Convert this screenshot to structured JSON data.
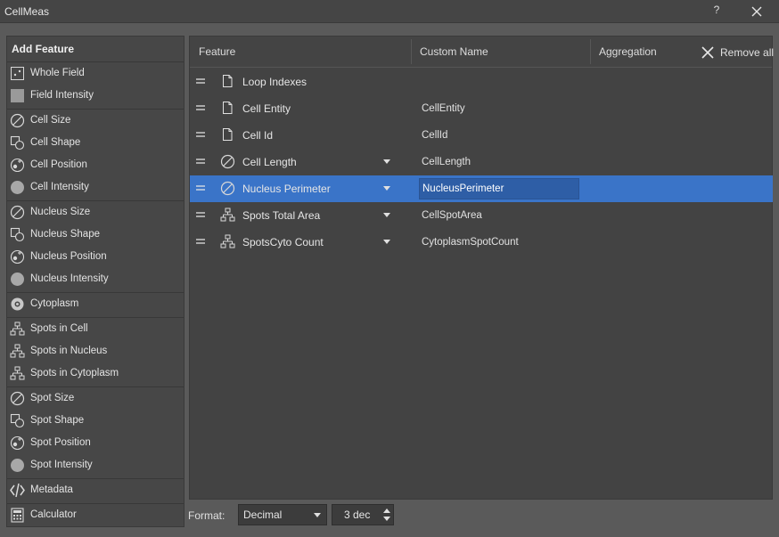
{
  "window": {
    "title": "CellMeas",
    "help_label": "?"
  },
  "sidebar": {
    "heading": "Add Feature",
    "groups": [
      {
        "items": [
          {
            "label": "Whole Field",
            "icon": "whole-field-icon"
          },
          {
            "label": "Field Intensity",
            "icon": "field-intensity-icon"
          }
        ]
      },
      {
        "items": [
          {
            "label": "Cell Size",
            "icon": "size-icon"
          },
          {
            "label": "Cell Shape",
            "icon": "shape-icon"
          },
          {
            "label": "Cell Position",
            "icon": "position-icon"
          },
          {
            "label": "Cell Intensity",
            "icon": "intensity-icon"
          }
        ]
      },
      {
        "items": [
          {
            "label": "Nucleus Size",
            "icon": "size-icon"
          },
          {
            "label": "Nucleus Shape",
            "icon": "shape-icon"
          },
          {
            "label": "Nucleus Position",
            "icon": "position-icon"
          },
          {
            "label": "Nucleus Intensity",
            "icon": "intensity-icon"
          }
        ]
      },
      {
        "items": [
          {
            "label": "Cytoplasm",
            "icon": "cytoplasm-icon"
          }
        ]
      },
      {
        "items": [
          {
            "label": "Spots in Cell",
            "icon": "hierarchy-icon"
          },
          {
            "label": "Spots in Nucleus",
            "icon": "hierarchy-icon"
          },
          {
            "label": "Spots in Cytoplasm",
            "icon": "hierarchy-icon"
          }
        ]
      },
      {
        "items": [
          {
            "label": "Spot Size",
            "icon": "size-icon"
          },
          {
            "label": "Spot Shape",
            "icon": "shape-icon"
          },
          {
            "label": "Spot Position",
            "icon": "position-icon"
          },
          {
            "label": "Spot Intensity",
            "icon": "intensity-icon"
          }
        ]
      },
      {
        "items": [
          {
            "label": "Metadata",
            "icon": "code-icon"
          }
        ]
      },
      {
        "items": [
          {
            "label": "Calculator",
            "icon": "calculator-icon"
          }
        ]
      }
    ]
  },
  "table": {
    "headers": {
      "feature": "Feature",
      "custom_name": "Custom Name",
      "aggregation": "Aggregation"
    },
    "remove_all_label": "Remove all",
    "rows": [
      {
        "feature": "Loop Indexes",
        "icon": "document-icon",
        "custom_name": "",
        "has_dropdown": false,
        "selected": false
      },
      {
        "feature": "Cell Entity",
        "icon": "document-icon",
        "custom_name": "CellEntity",
        "has_dropdown": false,
        "selected": false
      },
      {
        "feature": "Cell Id",
        "icon": "document-icon",
        "custom_name": "CellId",
        "has_dropdown": false,
        "selected": false
      },
      {
        "feature": "Cell Length",
        "icon": "size-icon",
        "custom_name": "CellLength",
        "has_dropdown": true,
        "selected": false
      },
      {
        "feature": "Nucleus Perimeter",
        "icon": "size-icon",
        "custom_name": "NucleusPerimeter",
        "has_dropdown": true,
        "selected": true
      },
      {
        "feature": "Spots Total Area",
        "icon": "hierarchy-icon",
        "custom_name": "CellSpotArea",
        "has_dropdown": true,
        "selected": false
      },
      {
        "feature": "SpotsCyto Count",
        "icon": "hierarchy-icon",
        "custom_name": "CytoplasmSpotCount",
        "has_dropdown": true,
        "selected": false
      }
    ]
  },
  "footer": {
    "format_label": "Format:",
    "format_value": "Decimal",
    "decimals_value": "3 dec"
  },
  "colors": {
    "selection": "#3a74c8",
    "background": "#5a5a5a",
    "panel": "#434343"
  }
}
